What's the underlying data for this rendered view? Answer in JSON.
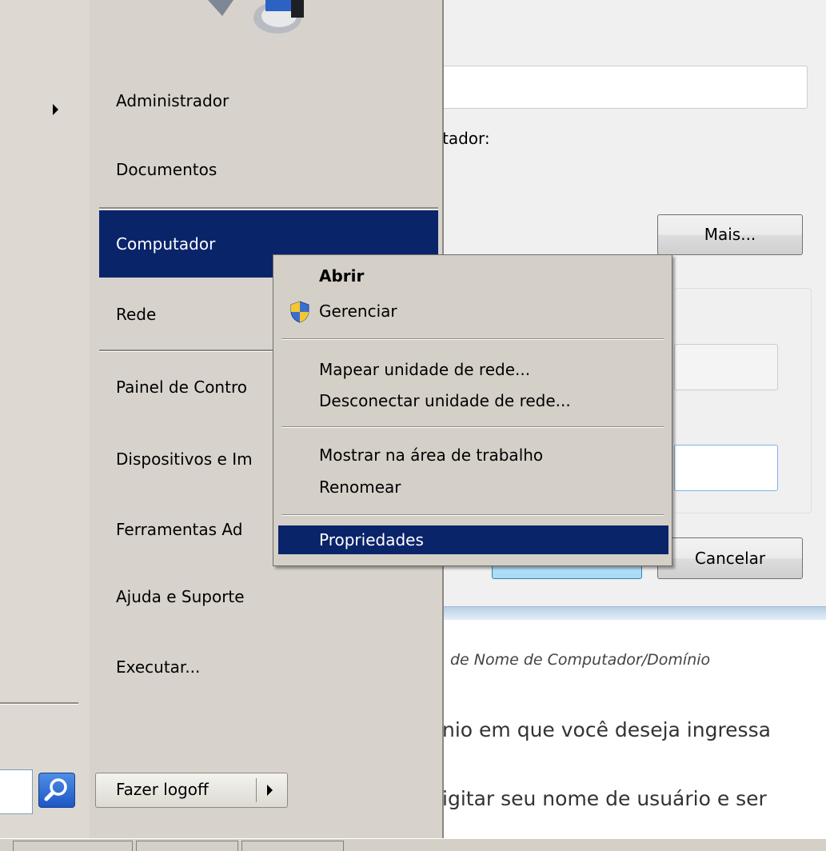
{
  "dialog": {
    "label_partial": "tador:",
    "more_button": "Mais...",
    "ok_button": "",
    "cancel_button": "Cancelar"
  },
  "help": {
    "italic_title": "de Nome de Computador/Domínio",
    "line1": "nio em que você deseja ingressa",
    "line2": "igitar seu nome de usuário e ser"
  },
  "start_menu": {
    "items": [
      {
        "label": "Administrador"
      },
      {
        "label": "Documentos"
      },
      {
        "label": "Computador"
      },
      {
        "label": "Rede"
      },
      {
        "label": "Painel de Contro"
      },
      {
        "label": "Dispositivos e Im"
      },
      {
        "label": "Ferramentas Ad"
      },
      {
        "label": "Ajuda e Suporte"
      },
      {
        "label": "Executar..."
      }
    ],
    "logoff_button": "Fazer logoff",
    "search_value": ""
  },
  "context_menu": {
    "items": [
      {
        "label": "Abrir"
      },
      {
        "label": "Gerenciar"
      },
      {
        "label": "Mapear unidade de rede..."
      },
      {
        "label": "Desconectar unidade de rede..."
      },
      {
        "label": "Mostrar na área de trabalho"
      },
      {
        "label": "Renomear"
      },
      {
        "label": "Propriedades"
      }
    ]
  },
  "icons": {
    "shield": "uac-shield-icon",
    "search": "magnifier-icon",
    "arrow": "right-arrow-icon",
    "user_picture": "computer-user-picture-icon"
  },
  "colors": {
    "highlight": "#0a246a",
    "menu_bg": "#d4d0c8"
  }
}
